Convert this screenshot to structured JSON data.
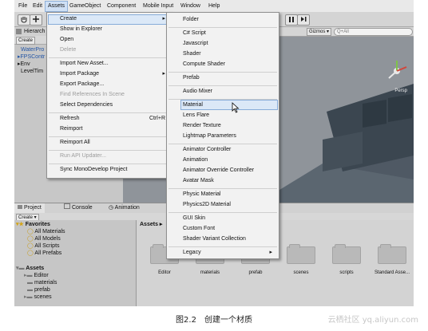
{
  "menubar": {
    "items": [
      "File",
      "Edit",
      "Assets",
      "GameObject",
      "Component",
      "Mobile Input",
      "Window",
      "Help"
    ]
  },
  "toolbar": {
    "pause_icon": "pause-icon",
    "step_icon": "step-icon"
  },
  "hierarchy": {
    "tab": "Hierarch",
    "create": "Create",
    "rows": [
      "WaterPro",
      "FPSContr",
      "Env",
      "LevelTim"
    ]
  },
  "scene": {
    "gizmos": "Gizmos",
    "search": "Q+All",
    "persp": "Persp"
  },
  "assets_menu": {
    "items": [
      {
        "label": "Create",
        "disabled": false,
        "arrow": true
      },
      {
        "label": "Show in Explorer",
        "disabled": false
      },
      {
        "label": "Open",
        "disabled": false
      },
      {
        "label": "Delete",
        "disabled": true
      },
      {
        "label": "Import New Asset...",
        "disabled": false
      },
      {
        "label": "Import Package",
        "disabled": false,
        "arrow": true
      },
      {
        "label": "Export Package...",
        "disabled": false
      },
      {
        "label": "Find References In Scene",
        "disabled": true
      },
      {
        "label": "Select Dependencies",
        "disabled": false
      },
      {
        "label": "Refresh",
        "disabled": false,
        "shortcut": "Ctrl+R"
      },
      {
        "label": "Reimport",
        "disabled": false
      },
      {
        "label": "Reimport All",
        "disabled": false
      },
      {
        "label": "Run API Updater...",
        "disabled": true
      },
      {
        "label": "Sync MonoDevelop Project",
        "disabled": false
      }
    ]
  },
  "create_menu": {
    "items": [
      "Folder",
      "C# Script",
      "Javascript",
      "Shader",
      "Compute Shader",
      "Prefab",
      "Audio Mixer",
      "Material",
      "Lens Flare",
      "Render Texture",
      "Lightmap Parameters",
      "Animator Controller",
      "Animation",
      "Animator Override Controller",
      "Avatar Mask",
      "Physic Material",
      "Physics2D Material",
      "GUI Skin",
      "Custom Font",
      "Shader Variant Collection",
      "Legacy"
    ],
    "highlighted": "Material"
  },
  "project": {
    "tabs": [
      "Project",
      "Console",
      "Animation"
    ],
    "create": "Create",
    "favorites_label": "Favorites",
    "favorites": [
      "All Materials",
      "All Models",
      "All Scripts",
      "All Prefabs"
    ],
    "assets_label": "Assets",
    "asset_tree": [
      "Editor",
      "materials",
      "prefab",
      "scenes"
    ],
    "breadcrumb": "Assets",
    "folders": [
      "Editor",
      "materials",
      "prefab",
      "scenes",
      "scripts",
      "Standard Asse..."
    ]
  },
  "caption": "图2.2　创建一个材质",
  "watermark": "云栖社区 yq.aliyun.com"
}
